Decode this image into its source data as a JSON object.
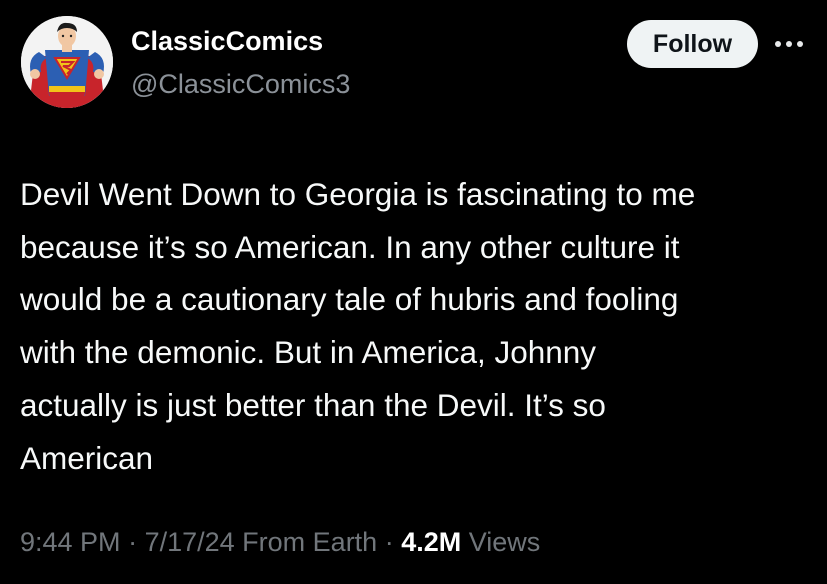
{
  "user": {
    "display_name": "ClassicComics",
    "handle": "@ClassicComics3",
    "avatar_icon": "superman-avatar-icon"
  },
  "actions": {
    "follow_label": "Follow",
    "more_icon": "more-options-icon"
  },
  "tweet": {
    "text": "Devil Went Down to Georgia is fascinating to me\nbecause it’s so American. In any other culture it\nwould be a cautionary tale of hubris and fooling\nwith the demonic. But in America, Johnny\nactually is just better than the Devil. It’s so\nAmerican"
  },
  "meta": {
    "time": "9:44 PM",
    "separator": " · ",
    "date": "7/17/24",
    "location": "From Earth",
    "views_count": "4.2M",
    "views_label": "Views"
  },
  "colors": {
    "background": "#000000",
    "text": "#e7e9ea",
    "secondary_text": "#71767b",
    "follow_button_bg": "#eff3f4",
    "follow_button_text": "#0f1419"
  }
}
